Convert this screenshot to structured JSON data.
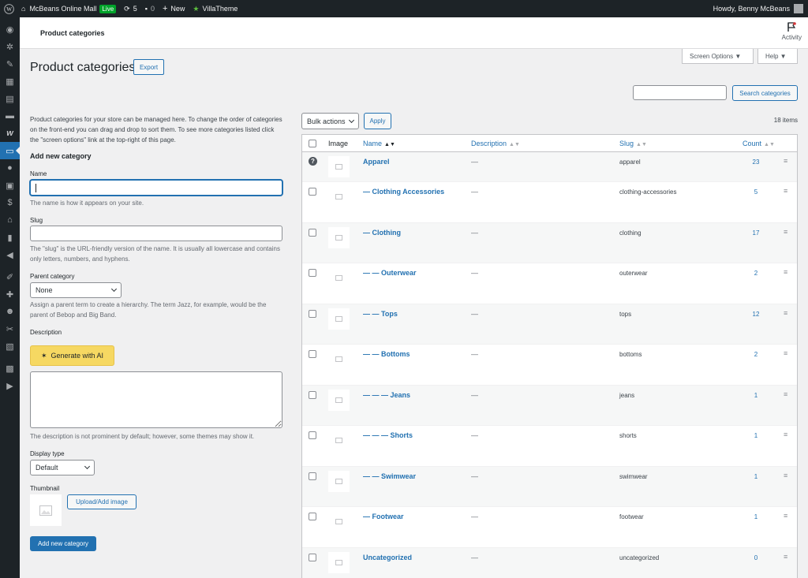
{
  "adminbar": {
    "site_name": "McBeans Online Mall",
    "live_badge": "Live",
    "updates_count": "5",
    "comments_count": "0",
    "new_label": "New",
    "villatheme_label": "VillaTheme",
    "howdy": "Howdy, Benny McBeans"
  },
  "header": {
    "title": "Product categories",
    "activity_label": "Activity"
  },
  "screen_options": {
    "screen_options_label": "Screen Options ▼",
    "help_label": "Help ▼"
  },
  "page": {
    "title": "Product categories",
    "export_label": "Export",
    "search_button": "Search categories",
    "search_value": ""
  },
  "form": {
    "intro": "Product categories for your store can be managed here. To change the order of categories on the front-end you can drag and drop to sort them. To see more categories listed click the \"screen options\" link at the top-right of this page.",
    "heading": "Add new category",
    "name_label": "Name",
    "name_value": "",
    "name_help": "The name is how it appears on your site.",
    "slug_label": "Slug",
    "slug_value": "",
    "slug_help": "The \"slug\" is the URL-friendly version of the name. It is usually all lowercase and contains only letters, numbers, and hyphens.",
    "parent_label": "Parent category",
    "parent_value": "None",
    "parent_help": "Assign a parent term to create a hierarchy. The term Jazz, for example, would be the parent of Bebop and Big Band.",
    "description_label": "Description",
    "ai_button": "Generate with AI",
    "description_help": "The description is not prominent by default; however, some themes may show it.",
    "display_type_label": "Display type",
    "display_type_value": "Default",
    "thumbnail_label": "Thumbnail",
    "upload_button": "Upload/Add image",
    "submit_button": "Add new category"
  },
  "tablenav": {
    "bulk_actions": "Bulk actions",
    "apply": "Apply",
    "items_count": "18 items"
  },
  "table": {
    "headers": {
      "image": "Image",
      "name": "Name",
      "description": "Description",
      "slug": "Slug",
      "count": "Count"
    },
    "rows": [
      {
        "name": "Apparel",
        "description": "—",
        "slug": "apparel",
        "count": "23"
      },
      {
        "name": "— Clothing Accessories",
        "description": "—",
        "slug": "clothing-accessories",
        "count": "5"
      },
      {
        "name": "— Clothing",
        "description": "—",
        "slug": "clothing",
        "count": "17"
      },
      {
        "name": "— — Outerwear",
        "description": "—",
        "slug": "outerwear",
        "count": "2"
      },
      {
        "name": "— — Tops",
        "description": "—",
        "slug": "tops",
        "count": "12"
      },
      {
        "name": "— — Bottoms",
        "description": "—",
        "slug": "bottoms",
        "count": "2"
      },
      {
        "name": "— — — Jeans",
        "description": "—",
        "slug": "jeans",
        "count": "1"
      },
      {
        "name": "— — — Shorts",
        "description": "—",
        "slug": "shorts",
        "count": "1"
      },
      {
        "name": "— — Swimwear",
        "description": "—",
        "slug": "swimwear",
        "count": "1"
      },
      {
        "name": "— Footwear",
        "description": "—",
        "slug": "footwear",
        "count": "1"
      },
      {
        "name": "Uncategorized",
        "description": "—",
        "slug": "uncategorized",
        "count": "0"
      }
    ]
  },
  "colors": {
    "accent": "#2271b1",
    "adminbar": "#1d2327",
    "ai_button": "#f6d862",
    "live": "#00a32a"
  },
  "icons": [
    "wordpress-icon",
    "home-icon",
    "updates-icon",
    "comment-icon",
    "plus-icon",
    "star-icon",
    "flag-icon",
    "help-icon",
    "image-placeholder-icon",
    "drag-handle-icon"
  ]
}
